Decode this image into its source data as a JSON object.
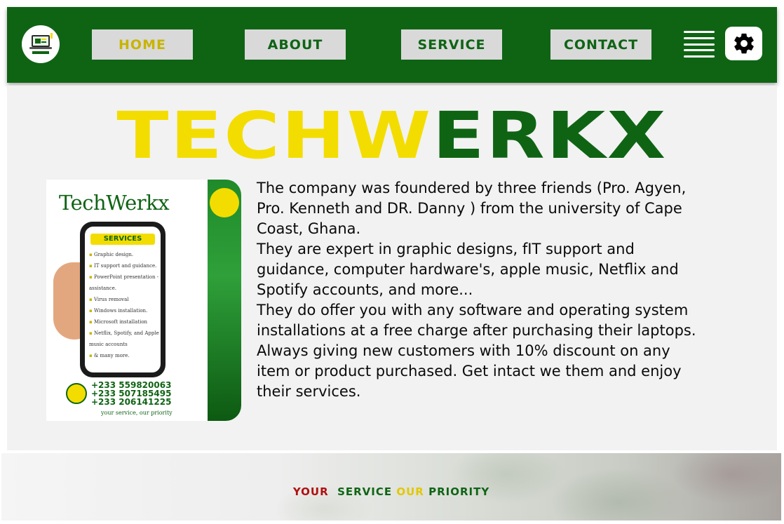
{
  "nav": {
    "items": [
      {
        "label": "HOME",
        "active": true
      },
      {
        "label": "ABOUT",
        "active": false
      },
      {
        "label": "SERVICE",
        "active": false
      },
      {
        "label": "CONTACT",
        "active": false
      }
    ],
    "menu_icon": "hamburger-icon",
    "settings_icon": "gear-icon"
  },
  "brand": {
    "parts": [
      "TECH",
      "W",
      "ERKX"
    ]
  },
  "flyer": {
    "title": "TechWerkx",
    "services_heading": "SERVICES",
    "services": [
      "Graphic design.",
      "IT support and guidance.",
      "PowerPoint presentation - assistance.",
      "Virus removal",
      "Windows installation.",
      "Microsoft installation",
      "Netflix, Spotify, and Apple music accounts",
      "& many more."
    ],
    "phones": [
      "+233 559820063",
      "+233 507185495",
      "+233 206141225"
    ],
    "tagline": "your service, our priority"
  },
  "about": {
    "paragraphs": [
      "The company was foundered by three friends (Pro. Agyen, Pro. Kenneth and DR. Danny ) from the university of Cape Coast, Ghana.",
      "They are expert in graphic designs, fIT support and guidance, computer hardware's, apple music, Netflix and Spotify accounts,  and more...",
      "They do offer you with any software and operating system installations at a free charge after purchasing their laptops.",
      "Always giving new customers with 10% discount on any item or product purchased. Get intact we them and enjoy their services."
    ]
  },
  "footer": {
    "slogan": [
      "YOUR",
      "SERVICE",
      "OUR",
      "PRIORITY"
    ]
  },
  "colors": {
    "brand_green": "#0f6414",
    "brand_yellow": "#f3dd00",
    "nav_button_bg": "#d9d9d9",
    "slogan_red": "#b00f0f"
  }
}
